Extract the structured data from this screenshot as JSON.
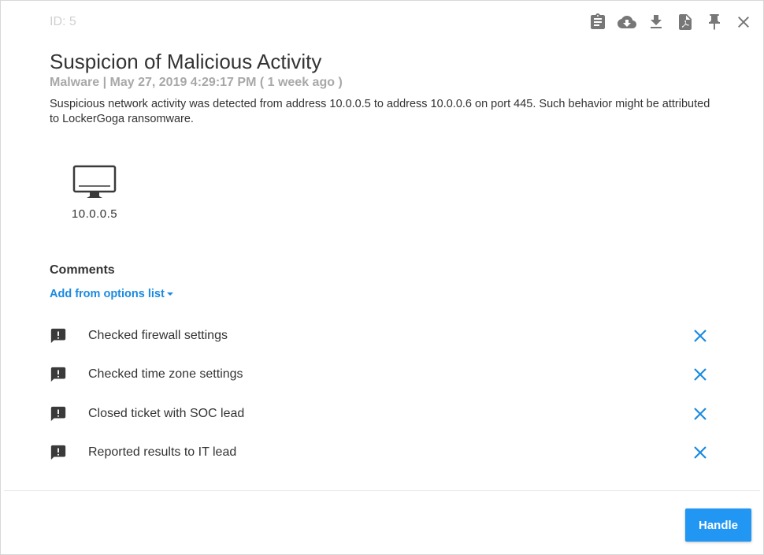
{
  "alert": {
    "id_label": "ID: 5",
    "title": "Suspicion of Malicious Activity",
    "meta": "Malware | May 27, 2019 4:29:17 PM ( 1 week ago )",
    "description": "Suspicious network activity was detected from address 10.0.0.5 to address 10.0.0.6 on port 445. Such behavior might be attributed to LockerGoga ransomware."
  },
  "toolbar": {
    "icons": [
      "clipboard-icon",
      "cloud-download-icon",
      "download-icon",
      "pdf-icon",
      "pin-icon",
      "close-icon"
    ]
  },
  "asset": {
    "icon": "monitor-icon",
    "label": "10.0.0.5"
  },
  "comments": {
    "heading": "Comments",
    "add_link": "Add from options list",
    "items": [
      {
        "text": "Checked firewall settings"
      },
      {
        "text": "Checked time zone settings"
      },
      {
        "text": "Closed ticket with SOC lead"
      },
      {
        "text": "Reported results to IT lead"
      }
    ]
  },
  "footer": {
    "handle_label": "Handle"
  },
  "colors": {
    "accent": "#2196f3",
    "link": "#1a8ae0",
    "icon_gray": "#777777",
    "muted_text": "#a8a8a8"
  }
}
